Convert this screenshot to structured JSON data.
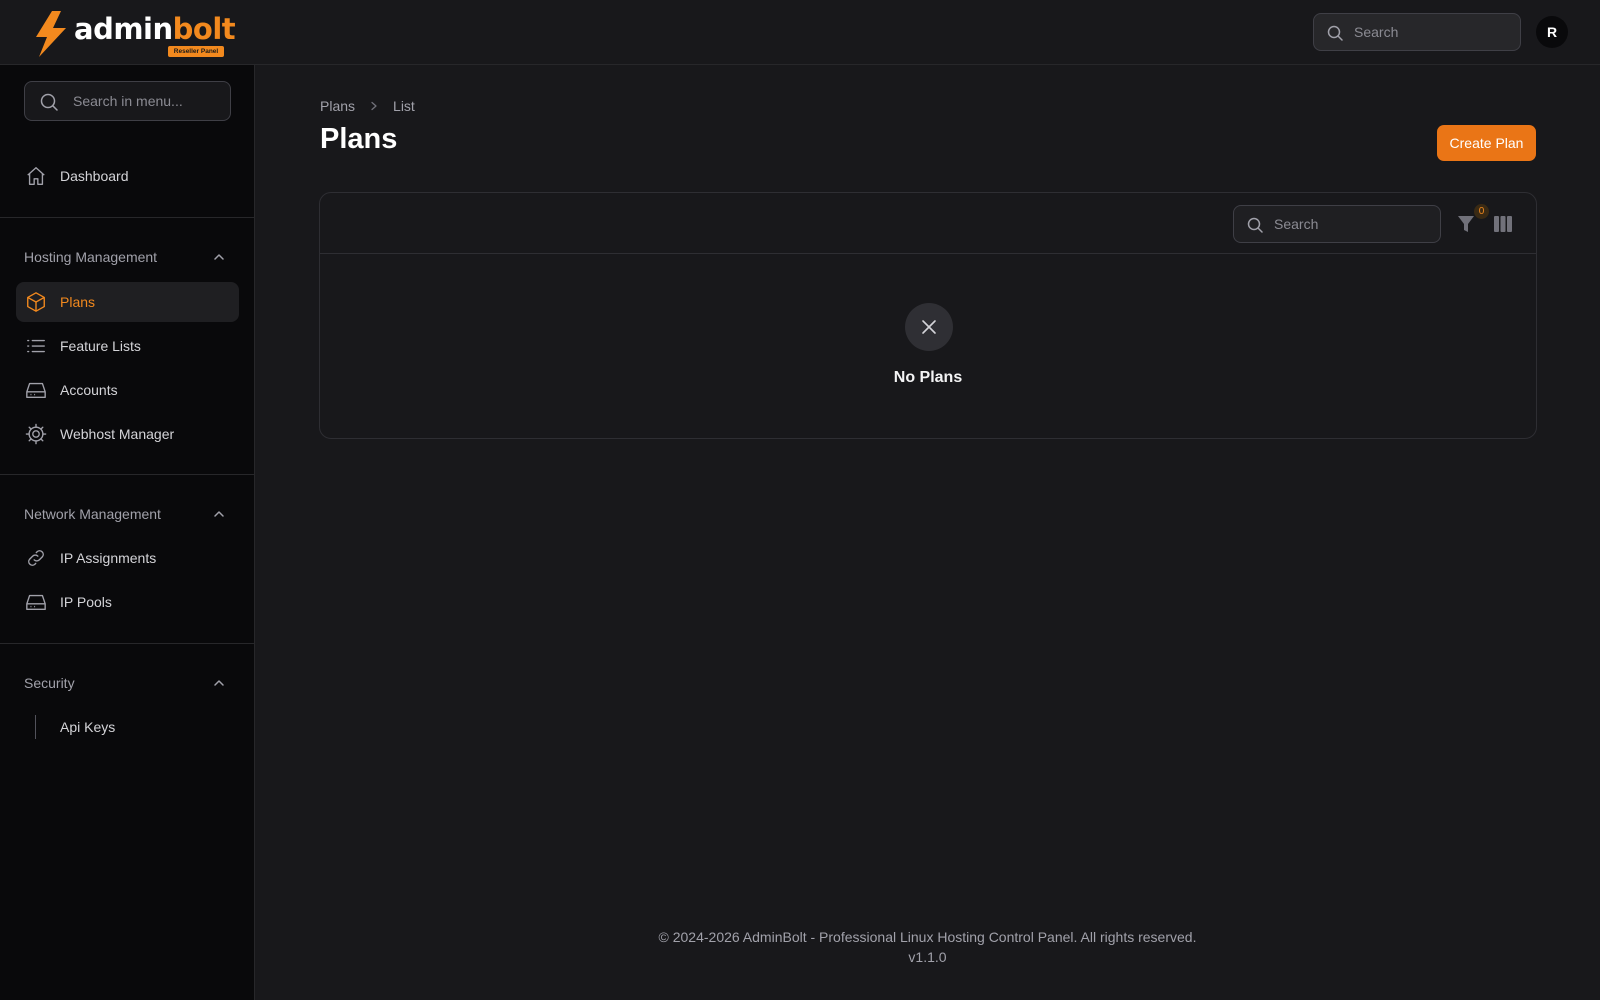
{
  "brand": {
    "name_part1": "admin",
    "name_part2": "bolt",
    "badge": "Reseller Panel"
  },
  "topbar": {
    "search_placeholder": "Search",
    "avatar_initial": "R"
  },
  "sidebar": {
    "search_placeholder": "Search in menu...",
    "dashboard": {
      "label": "Dashboard",
      "icon": "home-icon"
    },
    "groups": [
      {
        "label": "Hosting Management",
        "items": [
          {
            "label": "Plans",
            "icon": "cube-icon",
            "active": true
          },
          {
            "label": "Feature Lists",
            "icon": "list-icon"
          },
          {
            "label": "Accounts",
            "icon": "server-icon"
          },
          {
            "label": "Webhost Manager",
            "icon": "gear-icon"
          }
        ]
      },
      {
        "label": "Network Management",
        "items": [
          {
            "label": "IP Assignments",
            "icon": "link-icon"
          },
          {
            "label": "IP Pools",
            "icon": "server-icon"
          }
        ]
      },
      {
        "label": "Security",
        "items": [
          {
            "label": "Api Keys",
            "icon": "none"
          }
        ]
      }
    ]
  },
  "main": {
    "breadcrumb": [
      "Plans",
      "List"
    ],
    "title": "Plans",
    "create_button": "Create Plan",
    "table": {
      "search_placeholder": "Search",
      "filter_count": "0",
      "empty_text": "No Plans"
    }
  },
  "footer": {
    "copyright": "© 2024-2026 AdminBolt - Professional Linux Hosting Control Panel. All rights reserved.",
    "version": "v1.1.0"
  },
  "colors": {
    "accent": "#f2891e",
    "button": "#ea7516",
    "background": "#18181b",
    "sidebar": "#09090b"
  }
}
